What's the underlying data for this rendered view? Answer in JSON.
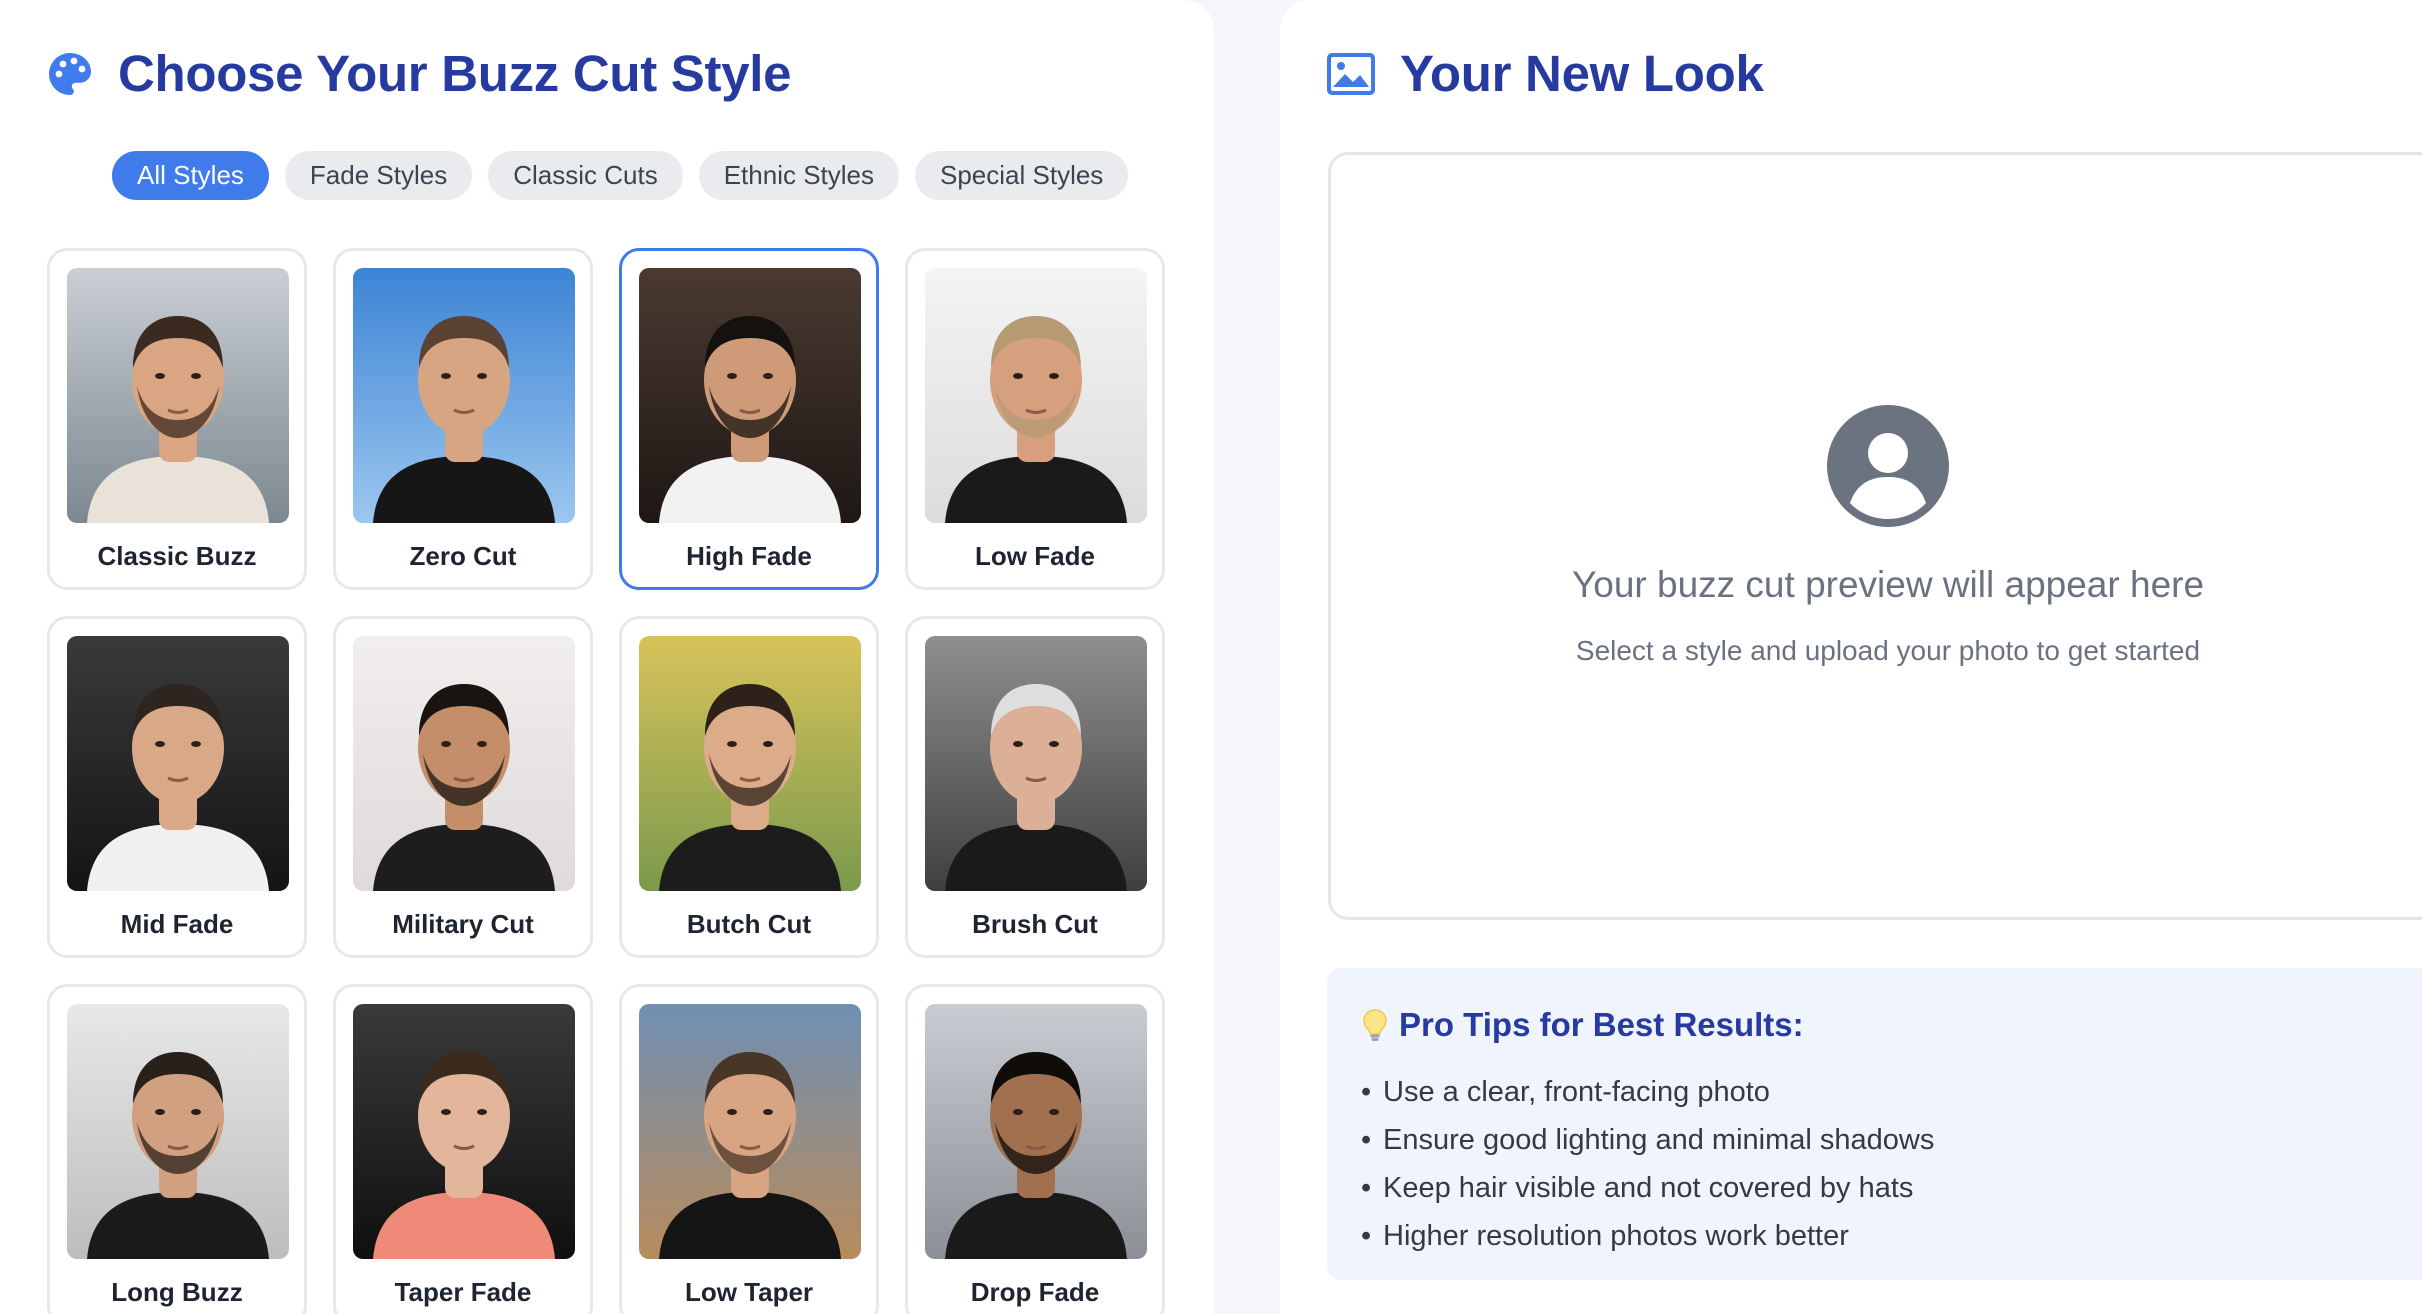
{
  "left_panel": {
    "title": "Choose Your Buzz Cut Style",
    "icon": "palette-icon",
    "filters": [
      {
        "label": "All Styles",
        "active": true
      },
      {
        "label": "Fade Styles",
        "active": false
      },
      {
        "label": "Classic Cuts",
        "active": false
      },
      {
        "label": "Ethnic Styles",
        "active": false
      },
      {
        "label": "Special Styles",
        "active": false
      }
    ],
    "styles": [
      {
        "name": "Classic Buzz",
        "selected": false
      },
      {
        "name": "Zero Cut",
        "selected": false
      },
      {
        "name": "High Fade",
        "selected": true
      },
      {
        "name": "Low Fade",
        "selected": false
      },
      {
        "name": "Mid Fade",
        "selected": false
      },
      {
        "name": "Military Cut",
        "selected": false
      },
      {
        "name": "Butch Cut",
        "selected": false
      },
      {
        "name": "Brush Cut",
        "selected": false
      },
      {
        "name": "Long Buzz",
        "selected": false
      },
      {
        "name": "Taper Fade",
        "selected": false
      },
      {
        "name": "Low Taper",
        "selected": false
      },
      {
        "name": "Drop Fade",
        "selected": false
      }
    ]
  },
  "right_panel": {
    "title": "Your New Look",
    "icon": "image-icon",
    "preview": {
      "icon": "user-avatar-icon",
      "text": "Your buzz cut preview will appear here",
      "subtext": "Select a style and upload your photo to get started"
    },
    "tips": {
      "icon": "lightbulb-icon",
      "title": "Pro Tips for Best Results:",
      "bullet": "•",
      "items": [
        "Use a clear, front-facing photo",
        "Ensure good lighting and minimal shadows",
        "Keep hair visible and not covered by hats",
        "Higher resolution photos work better"
      ]
    }
  },
  "colors": {
    "accent": "#3f7bea",
    "title": "#263a9f",
    "muted_text": "#6a7282"
  }
}
